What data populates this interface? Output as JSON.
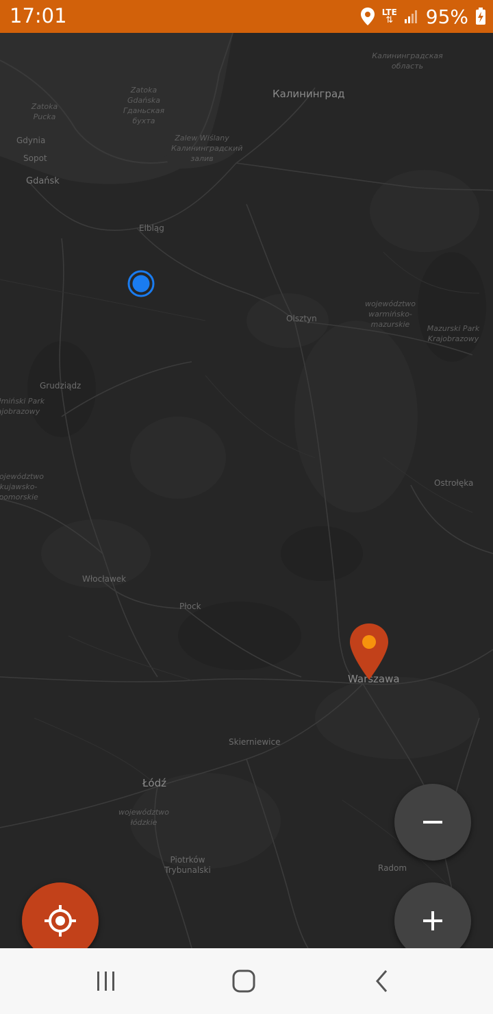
{
  "status_bar": {
    "time": "17:01",
    "network": "LTE",
    "battery": "95%",
    "color": "#d2610a"
  },
  "map": {
    "labels": {
      "kaliningrad_oblast": "Калининградская область",
      "kaliningrad": "Калининград",
      "gdansk_bay": "Zatoka Gdańska Гданьская бухта",
      "puck_bay": "Zatoka Pucka",
      "gdynia": "Gdynia",
      "sopot": "Sopot",
      "gdansk": "Gdańsk",
      "vistula_lagoon": "Zalew Wiślany Калининградский залив",
      "elblag": "Elbląg",
      "olsztyn": "Olsztyn",
      "warminsko": "województwo warmińsko-mazurskie",
      "mazurski": "Mazurski Park Krajobrazowy",
      "grudziadz": "Grudziądz",
      "chelminski": "Chełmiński Park Krajobrazowy",
      "kujawsko": "województwo kujawsko-pomorskie",
      "ostroleka": "Ostrołęka",
      "wloclawek": "Włocławek",
      "plock": "Płock",
      "warszawa": "Warszawa",
      "skierniewice": "Skierniewice",
      "lodz": "Łódź",
      "lodzkie": "województwo łódzkie",
      "piotrkow": "Piotrków Trybunalski",
      "radom": "Radom"
    }
  },
  "controls": {
    "zoom_out_icon": "minus-icon",
    "zoom_in_icon": "plus-icon",
    "locate_icon": "crosshair-icon",
    "locate_color": "#c2411a",
    "zoom_color": "#424242",
    "user_location_color": "#1a7cf0",
    "destination_pin_color": "#c2411a"
  },
  "nav_bar": {
    "recents_icon": "recent-apps-icon",
    "home_icon": "home-icon",
    "back_icon": "back-icon"
  }
}
